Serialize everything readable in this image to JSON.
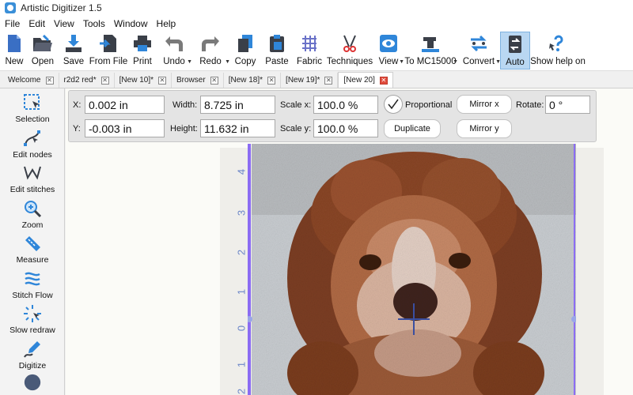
{
  "window": {
    "title": "Artistic Digitizer 1.5"
  },
  "menu": [
    "File",
    "Edit",
    "View",
    "Tools",
    "Window",
    "Help"
  ],
  "toolbar": [
    {
      "label": "New",
      "icon": "new-file-icon"
    },
    {
      "label": "Open",
      "icon": "open-folder-icon"
    },
    {
      "label": "Save",
      "icon": "save-icon"
    },
    {
      "label": "From File",
      "icon": "from-file-icon"
    },
    {
      "label": "Print",
      "icon": "print-icon"
    },
    {
      "label": "Undo",
      "icon": "undo-icon"
    },
    {
      "label": "Redo",
      "icon": "redo-icon"
    },
    {
      "label": "Copy",
      "icon": "copy-icon"
    },
    {
      "label": "Paste",
      "icon": "paste-icon"
    },
    {
      "label": "Fabric",
      "icon": "fabric-icon"
    },
    {
      "label": "Techniques",
      "icon": "techniques-icon"
    },
    {
      "label": "View",
      "icon": "view-eye-icon"
    },
    {
      "label": "To MC15000",
      "icon": "sewing-machine-icon"
    },
    {
      "label": "Convert",
      "icon": "convert-icon"
    },
    {
      "label": "Auto",
      "icon": "auto-icon"
    },
    {
      "label": "Show help on",
      "icon": "help-icon"
    }
  ],
  "tabs": [
    {
      "label": "Welcome"
    },
    {
      "label": "r2d2 red*"
    },
    {
      "label": "[New 10]*"
    },
    {
      "label": "Browser"
    },
    {
      "label": "[New 18]*"
    },
    {
      "label": "[New 19]*"
    },
    {
      "label": "[New 20]",
      "active": true
    }
  ],
  "side_tools": [
    {
      "label": "Selection",
      "icon": "selection-icon"
    },
    {
      "label": "Edit nodes",
      "icon": "edit-nodes-icon"
    },
    {
      "label": "Edit stitches",
      "icon": "edit-stitches-icon"
    },
    {
      "label": "Zoom",
      "icon": "zoom-icon"
    },
    {
      "label": "Measure",
      "icon": "measure-icon"
    },
    {
      "label": "Stitch Flow",
      "icon": "stitch-flow-icon"
    },
    {
      "label": "Slow redraw",
      "icon": "slow-redraw-icon"
    },
    {
      "label": "Digitize",
      "icon": "digitize-icon"
    }
  ],
  "props": {
    "x_label": "X:",
    "x_value": "0.002 in",
    "y_label": "Y:",
    "y_value": "-0.003 in",
    "width_label": "Width:",
    "width_value": "8.725 in",
    "height_label": "Height:",
    "height_value": "11.632 in",
    "scale_x_label": "Scale x:",
    "scale_x_value": "100.0 %",
    "scale_y_label": "Scale y:",
    "scale_y_value": "100.0 %",
    "proportional_label": "Proportional",
    "proportional_checked": true,
    "duplicate_label": "Duplicate",
    "mirror_x_label": "Mirror x",
    "mirror_y_label": "Mirror y",
    "rotate_label": "Rotate:",
    "rotate_value": "0 °"
  },
  "ruler": [
    "4",
    "3",
    "2",
    "1",
    "0",
    "1",
    "2"
  ],
  "colors": {
    "accent": "#7b5cf0",
    "active_tool": "#b9d7f2",
    "ruler": "#6b86c8"
  }
}
